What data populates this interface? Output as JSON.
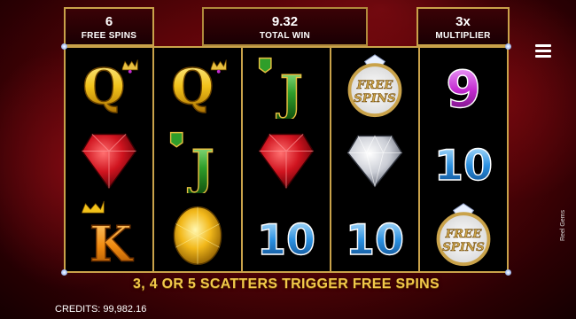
{
  "header": {
    "free_spins": {
      "value": "6",
      "label": "FREE SPINS"
    },
    "total_win": {
      "value": "9.32",
      "label": "TOTAL WIN"
    },
    "multiplier": {
      "value": "3x",
      "label": "MULTIPLIER"
    }
  },
  "menu_icon": "hamburger-menu-icon",
  "reels": [
    [
      "Q",
      "ruby",
      "K"
    ],
    [
      "Q",
      "J",
      "yellow-diamond"
    ],
    [
      "J",
      "ruby",
      "10"
    ],
    [
      "free-spins",
      "white-diamond",
      "10"
    ],
    [
      "9",
      "10",
      "free-spins"
    ]
  ],
  "symbol_text": {
    "q": "Q",
    "j": "J",
    "k": "K",
    "nine": "9",
    "ten": "10",
    "free": "FREE",
    "spins": "SPINS"
  },
  "message": "3, 4 OR 5 SCATTERS TRIGGER FREE SPINS",
  "credits": "CREDITS: 99,982.16",
  "game_name": "Reel Gems",
  "colors": {
    "frame_gold": "#c9a24a",
    "message_gold": "#f0c84a",
    "ruby_red": "#c1121c",
    "jack_green": "#2f9e2a",
    "nine_purple": "#c42bd1",
    "ten_blue": "#2a8fe0",
    "king_orange": "#f08a10"
  }
}
